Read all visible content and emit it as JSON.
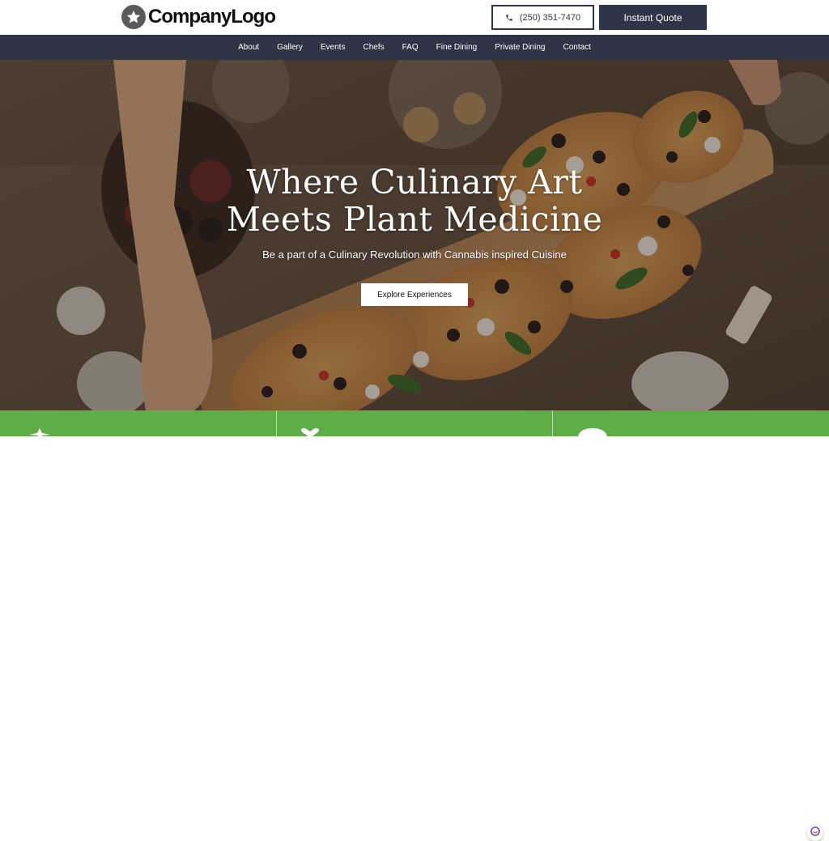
{
  "header": {
    "logo_text": "CompanyLogo",
    "logo_icon": "star-icon",
    "phone": {
      "label": "(250) 351-7470",
      "icon": "phone-icon"
    },
    "quote_label": "Instant Quote"
  },
  "nav": {
    "items": [
      {
        "label": "About"
      },
      {
        "label": "Gallery"
      },
      {
        "label": "Events"
      },
      {
        "label": "Chefs"
      },
      {
        "label": "FAQ"
      },
      {
        "label": "Fine Dining"
      },
      {
        "label": "Private Dining"
      },
      {
        "label": "Contact"
      }
    ]
  },
  "hero": {
    "title_line1": "Where Culinary Art",
    "title_line2": "Meets Plant Medicine",
    "subtitle": "Be a part of a Culinary Revolution with Cannabis inspired Cuisine",
    "cta_label": "Explore Experiences"
  },
  "band": {
    "icons": [
      "leaf-icon",
      "heart-icon",
      "chef-icon"
    ]
  },
  "colors": {
    "navy": "#2f3547",
    "green": "#5fad46",
    "white": "#ffffff"
  }
}
